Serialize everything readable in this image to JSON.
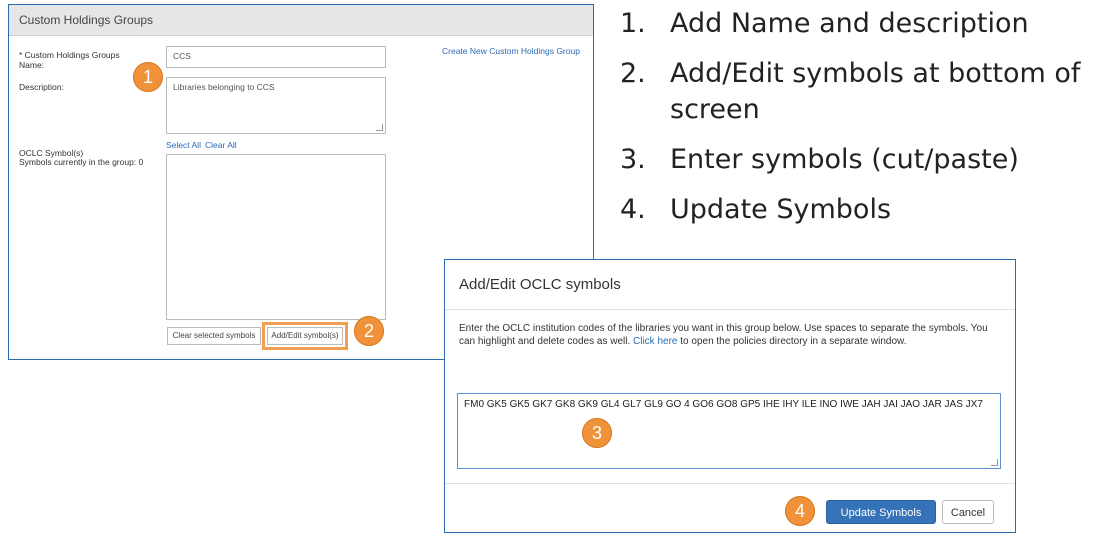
{
  "panel": {
    "title": "Custom Holdings Groups",
    "name_label": "* Custom Holdings Groups Name:",
    "name_value": "CCS",
    "create_link": "Create New Custom Holdings Group",
    "description_label": "Description:",
    "description_value": "Libraries belonging to CCS",
    "select_all": "Select All",
    "clear_all": "Clear All",
    "symbols_label": "OCLC Symbol(s)",
    "symbols_count": "Symbols currently in the group: 0",
    "clear_selected_button": "Clear selected symbols",
    "add_edit_button": "Add/Edit symbol(s)"
  },
  "steps": [
    {
      "num": "1.",
      "text": "Add Name and description"
    },
    {
      "num": "2.",
      "text": "Add/Edit symbols at bottom of screen"
    },
    {
      "num": "3.",
      "text": "Enter symbols (cut/paste)"
    },
    {
      "num": "4.",
      "text": "Update Symbols"
    }
  ],
  "dialog": {
    "title": "Add/Edit OCLC symbols",
    "text_before_link": "Enter the OCLC institution codes of the libraries you want in this group below. Use spaces to separate the symbols. You can highlight and delete codes as well. ",
    "link_text": "Click here",
    "text_after_link": " to open the policies directory in a separate window.",
    "symbols_value": "FM0 GK5 GK5 GK7 GK8 GK9 GL4 GL7 GL9 GO 4 GO6 GO8 GP5 IHE IHY ILE INO IWE JAH JAI JAO JAR JAS JX7",
    "update_button": "Update Symbols",
    "cancel_button": "Cancel"
  },
  "badges": {
    "one": "1",
    "two": "2",
    "three": "3",
    "four": "4"
  },
  "colors": {
    "badge": "#f0923a",
    "link": "#2a6ab4",
    "primary": "#3572b8",
    "border": "#2b6cb0"
  }
}
